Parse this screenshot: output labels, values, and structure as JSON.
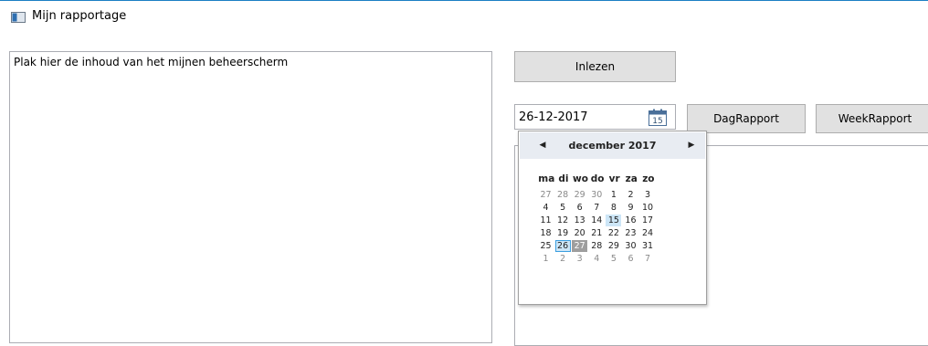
{
  "window": {
    "title": "Mijn rapportage",
    "icon": "window-app-icon"
  },
  "textarea": {
    "placeholder": "Plak hier de inhoud van het mijnen beheerscherm"
  },
  "buttons": {
    "inlezen": "Inlezen",
    "dagrapport": "DagRapport",
    "weekrapport": "WeekRapport"
  },
  "datepicker": {
    "value": "26-12-2017",
    "icon": "calendar-icon",
    "icon_text": "15"
  },
  "calendar": {
    "month_label": "december 2017",
    "prev_icon": "chevron-left-icon",
    "next_icon": "chevron-right-icon",
    "weekdays": [
      "ma",
      "di",
      "wo",
      "do",
      "vr",
      "za",
      "zo"
    ],
    "weeks": [
      [
        {
          "d": "27",
          "o": true
        },
        {
          "d": "28",
          "o": true
        },
        {
          "d": "29",
          "o": true
        },
        {
          "d": "30",
          "o": true
        },
        {
          "d": "1"
        },
        {
          "d": "2"
        },
        {
          "d": "3"
        }
      ],
      [
        {
          "d": "4"
        },
        {
          "d": "5"
        },
        {
          "d": "6"
        },
        {
          "d": "7"
        },
        {
          "d": "8"
        },
        {
          "d": "9"
        },
        {
          "d": "10"
        }
      ],
      [
        {
          "d": "11"
        },
        {
          "d": "12"
        },
        {
          "d": "13"
        },
        {
          "d": "14"
        },
        {
          "d": "15",
          "s": "today"
        },
        {
          "d": "16"
        },
        {
          "d": "17"
        }
      ],
      [
        {
          "d": "18"
        },
        {
          "d": "19"
        },
        {
          "d": "20"
        },
        {
          "d": "21"
        },
        {
          "d": "22"
        },
        {
          "d": "23"
        },
        {
          "d": "24"
        }
      ],
      [
        {
          "d": "25"
        },
        {
          "d": "26",
          "s": "selected"
        },
        {
          "d": "27",
          "s": "hover"
        },
        {
          "d": "28"
        },
        {
          "d": "29"
        },
        {
          "d": "30"
        },
        {
          "d": "31"
        }
      ],
      [
        {
          "d": "1",
          "o": true
        },
        {
          "d": "2",
          "o": true
        },
        {
          "d": "3",
          "o": true
        },
        {
          "d": "4",
          "o": true
        },
        {
          "d": "5",
          "o": true
        },
        {
          "d": "6",
          "o": true
        },
        {
          "d": "7",
          "o": true
        }
      ]
    ]
  },
  "colors": {
    "accent": "#1c7fc4",
    "selected_border": "#3c9fe0",
    "today_bg": "#cde6f7",
    "hover_bg": "#9e9e9e"
  }
}
